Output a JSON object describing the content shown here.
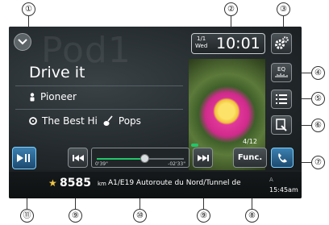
{
  "callouts": [
    "①",
    "②",
    "③",
    "④",
    "⑤",
    "⑥",
    "⑦",
    "⑧",
    "⑨",
    "⑩",
    "⑨",
    "⑪"
  ],
  "watermark": "Pod1",
  "track": {
    "title": "Drive it",
    "artist": "Pioneer",
    "album": "The Best Hi",
    "genre": "Pops"
  },
  "clock": {
    "date": "1/1",
    "day": "Wed",
    "time": "10:01"
  },
  "buttons": {
    "eq_label": "EQ",
    "func_label": "Func."
  },
  "track_count": "4/12",
  "seek": {
    "elapsed": "0'39\"",
    "remaining": "-02'33\"",
    "progress": 0.55
  },
  "navigation": {
    "distance_a": "85",
    "distance_b": "85",
    "unit": "km",
    "road": "A1/E19 Autoroute du Nord/Tunnel de",
    "arrival_label": "A",
    "arrival_time": "15:45am"
  },
  "colors": {
    "accent_blue": "#2e78b8",
    "progress_green": "#22c76a",
    "star_gold": "#f2c744"
  }
}
